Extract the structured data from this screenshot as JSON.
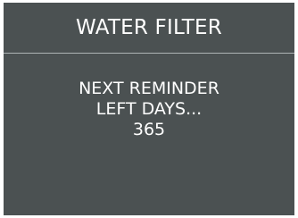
{
  "screen": {
    "title": "WATER FILTER",
    "reminder_label": "NEXT REMINDER",
    "days_label": "LEFT DAYS...",
    "days_value": "365"
  },
  "colors": {
    "background": "#4b5152",
    "text": "#ffffff",
    "divider": "#aeb3b4"
  }
}
